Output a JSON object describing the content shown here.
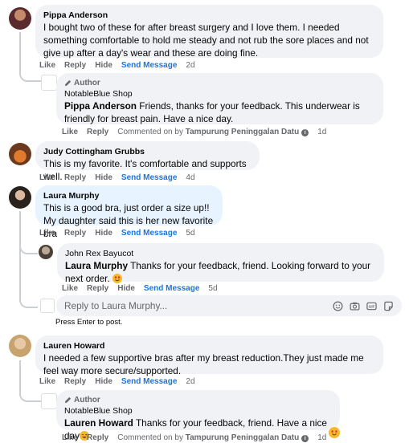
{
  "comments": [
    {
      "author": "Pippa Anderson",
      "text": "I bought two of these for after breast surgery and I love them. I needed something comfortable to hold me steady and not rub the sore places and not give up after a day's wear and these are doing fine.",
      "actions": {
        "like": "Like",
        "reply": "Reply",
        "hide": "Hide",
        "send": "Send Message",
        "time": "2d"
      },
      "reply": {
        "badge": "Author",
        "author": "NotableBlue Shop",
        "mention": "Pippa Anderson",
        "text": " Friends, thanks for your feedback. This underwear is friendly for breast pain. Have a nice day.",
        "actions": {
          "like": "Like",
          "reply": "Reply",
          "commented_prefix": "Commented on by",
          "commented_by": "Tampurung Peninggalan Datu",
          "time": "1d"
        }
      }
    },
    {
      "author": "Judy Cottingham Grubbs",
      "text": "This is my favorite. It's comfortable and supports well.",
      "actions": {
        "like": "Like",
        "reply": "Reply",
        "hide": "Hide",
        "send": "Send Message",
        "time": "4d"
      }
    },
    {
      "author": "Laura Murphy",
      "line1": "This is a good bra, just order a size up!!",
      "line2": "My daughter said this is her new favorite bra",
      "actions": {
        "like": "Like",
        "reply": "Reply",
        "hide": "Hide",
        "send": "Send Message",
        "time": "5d"
      },
      "reply": {
        "author": "John Rex Bayucot",
        "mention": "Laura Murphy",
        "text": " Thanks for your feedback, friend. Looking forward to your next order.",
        "actions": {
          "like": "Like",
          "reply": "Reply",
          "hide": "Hide",
          "send": "Send Message",
          "time": "5d"
        }
      },
      "reply_box": {
        "placeholder": "Reply to Laura Murphy...",
        "hint": "Press Enter to post."
      }
    },
    {
      "author": "Lauren Howard",
      "text": "I needed a few supportive bras after my breast reduction.They just made me feel way more secure/supported.",
      "actions": {
        "like": "Like",
        "reply": "Reply",
        "hide": "Hide",
        "send": "Send Message",
        "time": "2d"
      },
      "reply": {
        "badge": "Author",
        "author": "NotableBlue Shop",
        "mention": "Lauren Howard",
        "text": " Thanks for your feedback, friend. Have a nice day",
        "actions": {
          "like": "Like",
          "reply": "Reply",
          "commented_prefix": "Commented on by",
          "commented_by": "Tampurung Peninggalan Datu",
          "time": "1d"
        }
      }
    }
  ],
  "colors": {
    "bubble": "#f0f2f5",
    "highlight": "#e7f3ff",
    "link": "#1b74e4",
    "muted": "#65676b"
  }
}
